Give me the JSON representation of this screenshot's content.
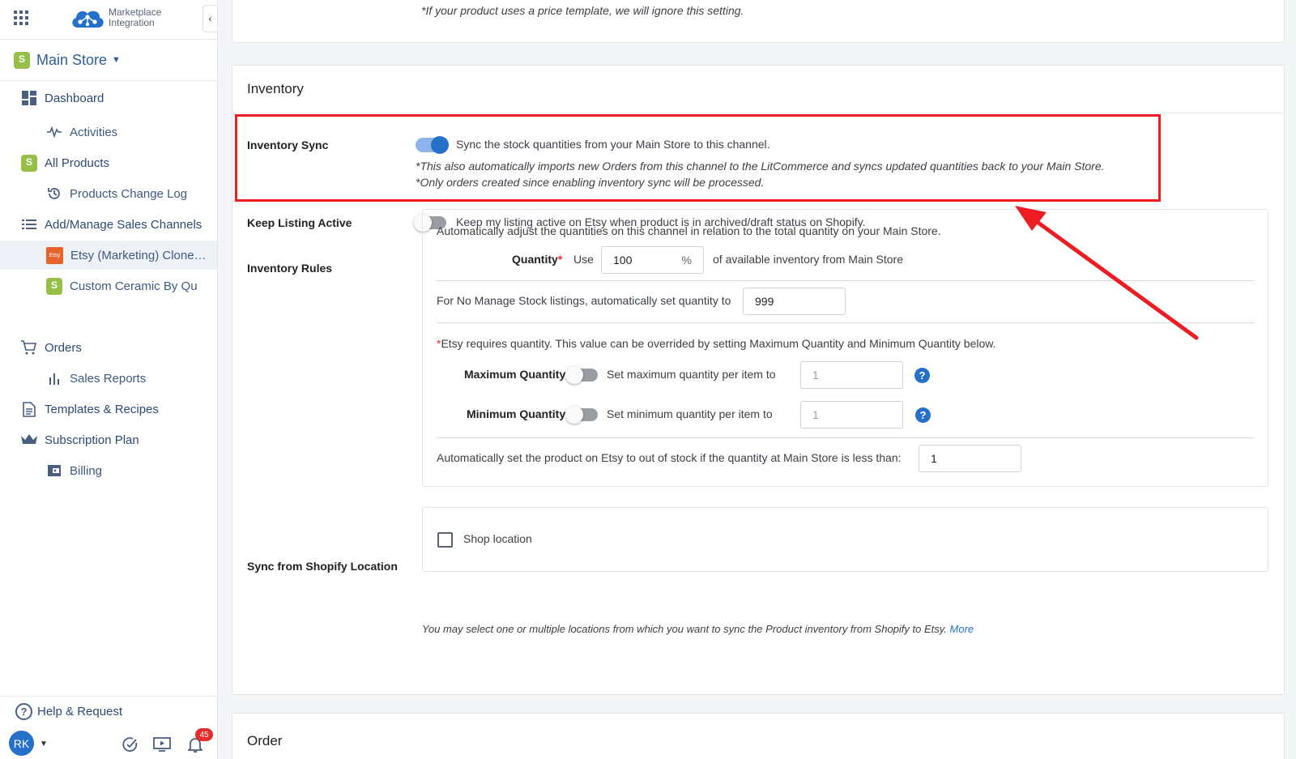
{
  "app": {
    "logo_line1": "Marketplace",
    "logo_line2": "Integration",
    "collapse_glyph": "‹"
  },
  "store": {
    "name": "Main Store",
    "caret": "⌄"
  },
  "nav": [
    {
      "label": "Dashboard",
      "icon": "dashboard-icon"
    },
    {
      "label": "Activities",
      "icon": "activity-icon"
    },
    {
      "label": "All Products",
      "icon": "shopify-bag-icon"
    },
    {
      "label": "Products Change Log",
      "icon": "history-icon"
    },
    {
      "label": "Add/Manage Sales Channels",
      "icon": "list-icon"
    },
    {
      "label": "Etsy (Marketing) Clone…",
      "icon": "etsy-icon"
    },
    {
      "label": "Custom Ceramic By Qu",
      "icon": "shopify-bag-icon"
    },
    {
      "label": "Orders",
      "icon": "cart-icon"
    },
    {
      "label": "Sales Reports",
      "icon": "bar-chart-icon"
    },
    {
      "label": "Templates & Recipes",
      "icon": "document-icon"
    },
    {
      "label": "Subscription Plan",
      "icon": "crown-icon"
    },
    {
      "label": "Billing",
      "icon": "wallet-icon"
    }
  ],
  "etsy_badge": "Etsy",
  "bottom": {
    "help_label": "Help & Request",
    "avatar": "RK",
    "notifications": "45"
  },
  "top_note": "*If your product uses a price template, we will ignore this setting.",
  "inventory": {
    "title": "Inventory",
    "sync_label": "Inventory Sync",
    "sync_text": "Sync the stock quantities from your Main Store to this channel.",
    "sync_note1": "*This also automatically imports new Orders from this channel to the LitCommerce and syncs updated quantities back to your Main Store.",
    "sync_note2": "*Only orders created since enabling inventory sync will be processed.",
    "keep_label": "Keep Listing Active",
    "keep_text": "Keep my listing active on Etsy when product is in archived/draft status on Shopify.",
    "rules_label": "Inventory Rules",
    "rules_intro": "Automatically adjust the quantities on this channel in relation to the total quantity on your Main Store.",
    "quantity_label": "Quantity",
    "required_mark": "*",
    "use_label": "Use",
    "quantity_value": "100",
    "percent": "%",
    "quantity_suffix": "of available inventory from Main Store",
    "no_manage_label": "For No Manage Stock listings, automatically set quantity to",
    "no_manage_value": "999",
    "etsy_note": "Etsy requires quantity. This value can be overrided by setting Maximum Quantity and Minimum Quantity below.",
    "max_label": "Maximum Quantity",
    "max_text": "Set maximum quantity per item to",
    "max_value": "1",
    "min_label": "Minimum Quantity",
    "min_text": "Set minimum quantity per item to",
    "min_value": "1",
    "oos_label": "Automatically set the product on Etsy to out of stock if the quantity at Main Store is less than:",
    "oos_value": "1",
    "location_label": "Sync from Shopify Location",
    "shop_location": "Shop location",
    "location_note": "You may select one or multiple locations from which you want to sync the Product inventory from Shopify to Etsy.",
    "more_link": "More"
  },
  "order": {
    "title": "Order"
  },
  "colors": {
    "accent": "#2570c9",
    "highlight": "#ee1d23"
  }
}
